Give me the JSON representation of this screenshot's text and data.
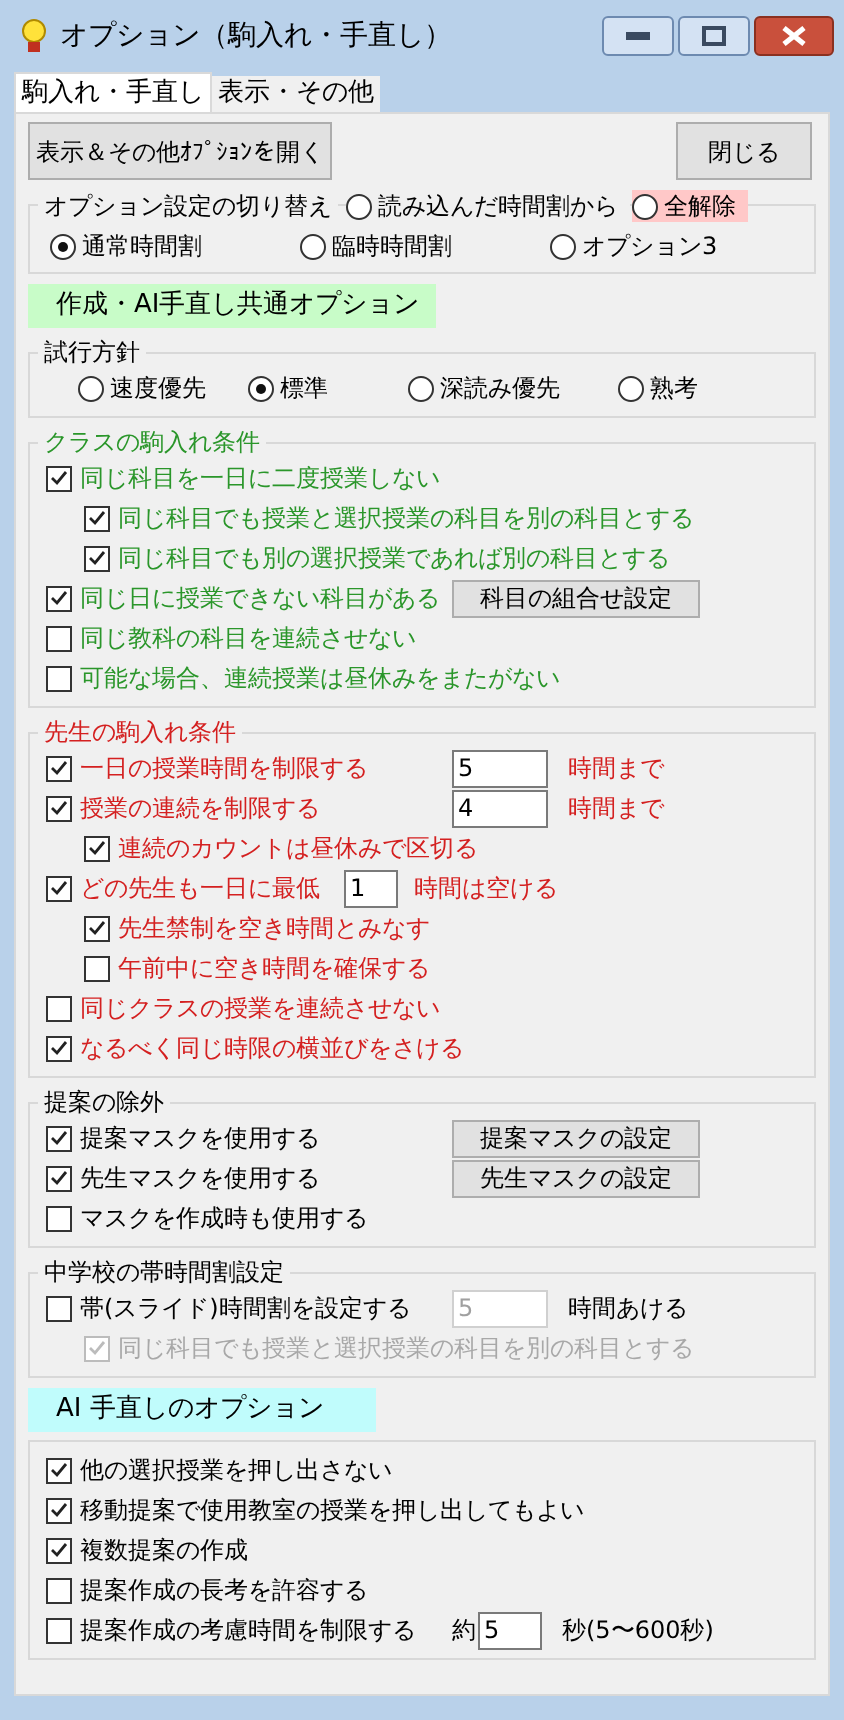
{
  "window": {
    "title": "オプション（駒入れ・手直し）"
  },
  "tabs": [
    {
      "label": "駒入れ・手直し",
      "selected": true
    },
    {
      "label": "表示・その他",
      "selected": false
    }
  ],
  "toolbar": {
    "open_button": "表示＆その他ｵﾌﾟｼｮﾝを開く",
    "close_button": "閉じる"
  },
  "option_switch": {
    "title": "オプション設定の切り替え",
    "top_radios": [
      {
        "label": "読み込んだ時間割から",
        "selected": false
      },
      {
        "label": "全解除",
        "selected": false,
        "color": "#ffc8c8"
      }
    ],
    "radios": [
      {
        "label": "通常時間割",
        "selected": true
      },
      {
        "label": "臨時時間割",
        "selected": false
      },
      {
        "label": "オプション3",
        "selected": false
      }
    ]
  },
  "sections": [
    {
      "title": "作成・AI手直し共通オプション",
      "color": "#c8fcc8",
      "groups": [
        {
          "kind": "radios",
          "title": "試行方針",
          "options": [
            {
              "label": "速度優先",
              "selected": false
            },
            {
              "label": "標準",
              "selected": true
            },
            {
              "label": "深読み優先",
              "selected": false
            },
            {
              "label": "熟考",
              "selected": false
            }
          ]
        },
        {
          "kind": "checks",
          "title": "クラスの駒入れ条件",
          "color": "#2a962a",
          "items": [
            {
              "kind": "check",
              "label": "同じ科目を一日に二度授業しない",
              "checked": true,
              "children": [
                {
                  "kind": "check",
                  "label": "同じ科目でも授業と選択授業の科目を別の科目とする",
                  "checked": true
                },
                {
                  "kind": "check",
                  "label": "同じ科目でも別の選択授業であれば別の科目とする",
                  "checked": true
                }
              ]
            },
            {
              "kind": "check_button",
              "label": "同じ日に授業できない科目がある",
              "checked": true,
              "button": "科目の組合せ設定"
            },
            {
              "kind": "check",
              "label": "同じ教科の科目を連続させない",
              "checked": false
            },
            {
              "kind": "check",
              "label": "可能な場合、連続授業は昼休みをまたがない",
              "checked": false
            }
          ]
        },
        {
          "kind": "checks",
          "title": "先生の駒入れ条件",
          "color": "#d42020",
          "items": [
            {
              "kind": "check_field",
              "label": "一日の授業時間を制限する",
              "checked": true,
              "value": "5",
              "suffix": "時間まで"
            },
            {
              "kind": "check_field",
              "label": "授業の連続を制限する",
              "checked": true,
              "value": "4",
              "suffix": "時間まで",
              "children": [
                {
                  "kind": "check",
                  "label": "連続のカウントは昼休みで区切る",
                  "checked": true
                }
              ]
            },
            {
              "kind": "check_inline_field",
              "label": "どの先生も一日に最低",
              "checked": true,
              "value": "1",
              "suffix": "時間は空ける",
              "children": [
                {
                  "kind": "check",
                  "label": "先生禁制を空き時間とみなす",
                  "checked": true
                },
                {
                  "kind": "check",
                  "label": "午前中に空き時間を確保する",
                  "checked": false
                }
              ]
            },
            {
              "kind": "check",
              "label": "同じクラスの授業を連続させない",
              "checked": false
            },
            {
              "kind": "check",
              "label": "なるべく同じ時限の横並びをさける",
              "checked": true
            }
          ]
        },
        {
          "kind": "checks",
          "title": "提案の除外",
          "color": "#000000",
          "items": [
            {
              "kind": "check_button",
              "label": "提案マスクを使用する",
              "checked": true,
              "button": "提案マスクの設定"
            },
            {
              "kind": "check_button",
              "label": "先生マスクを使用する",
              "checked": true,
              "button": "先生マスクの設定"
            },
            {
              "kind": "check",
              "label": "マスクを作成時も使用する",
              "checked": false
            }
          ]
        },
        {
          "kind": "checks",
          "title": "中学校の帯時間割設定",
          "color": "#000000",
          "items": [
            {
              "kind": "check_field",
              "label": "帯(スライド)時間割を設定する",
              "checked": false,
              "value": "5",
              "field_disabled": true,
              "suffix": "時間あける",
              "children": [
                {
                  "kind": "check",
                  "label": "同じ科目でも授業と選択授業の科目を別の科目とする",
                  "checked": true,
                  "disabled": true
                }
              ]
            }
          ]
        }
      ]
    },
    {
      "title": "AI 手直しのオプション",
      "color": "#c0fcfc",
      "groups": [
        {
          "kind": "checks",
          "color": "#000000",
          "items": [
            {
              "kind": "check",
              "label": "他の選択授業を押し出さない",
              "checked": true
            },
            {
              "kind": "check",
              "label": "移動提案で使用教室の授業を押し出してもよい",
              "checked": true
            },
            {
              "kind": "check",
              "label": "複数提案の作成",
              "checked": true
            },
            {
              "kind": "check",
              "label": "提案作成の長考を許容する",
              "checked": false
            },
            {
              "kind": "check_field",
              "label": "提案作成の考慮時間を制限する",
              "checked": false,
              "prefix": "約",
              "value": "5",
              "suffix": "秒(5〜600秒)"
            }
          ]
        }
      ]
    }
  ]
}
